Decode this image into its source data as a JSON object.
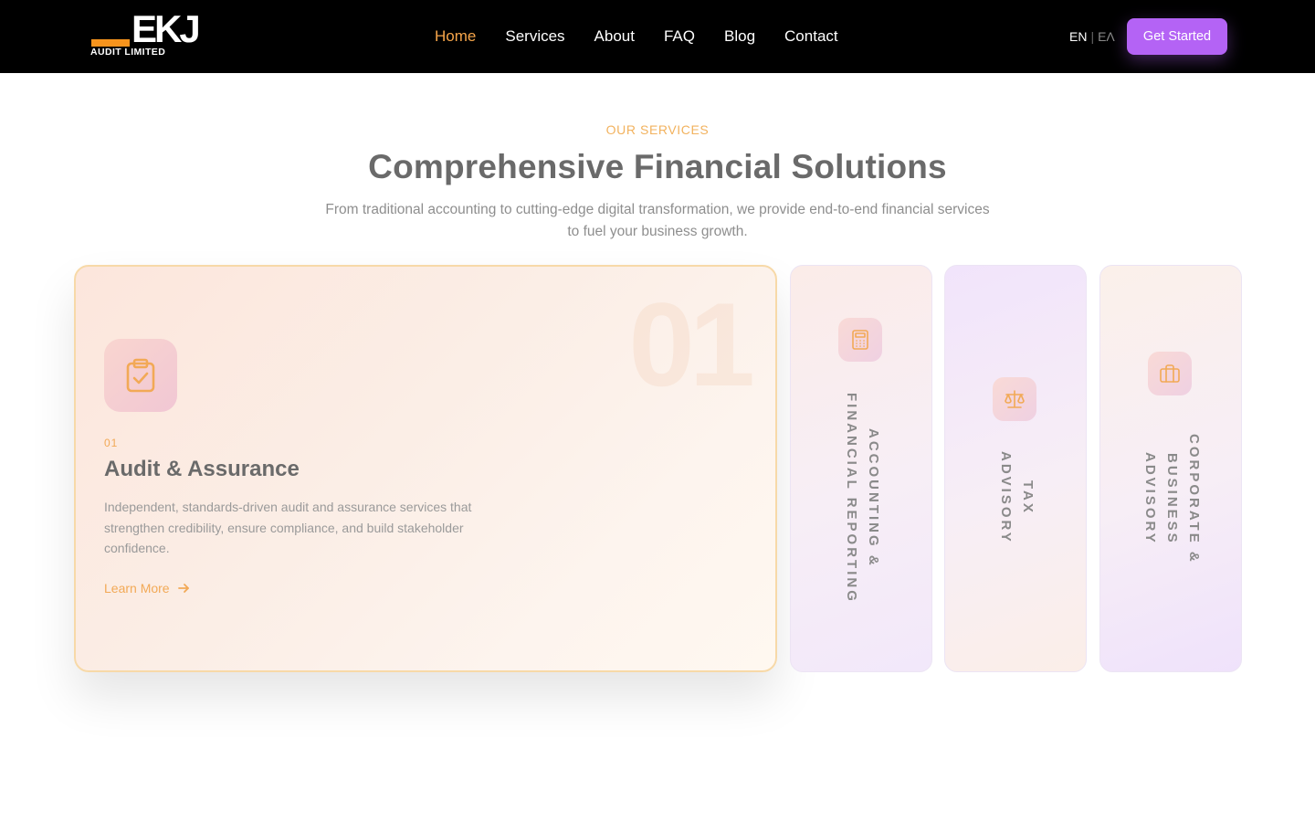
{
  "brand": {
    "mark": "EKJ",
    "sub": "AUDIT LIMITED",
    "accent": "#f7941d"
  },
  "nav": {
    "items": [
      {
        "label": "Home"
      },
      {
        "label": "Services"
      },
      {
        "label": "About"
      },
      {
        "label": "FAQ"
      },
      {
        "label": "Blog"
      },
      {
        "label": "Contact"
      }
    ],
    "active_color": "#f6a54a"
  },
  "lang": {
    "current": "EN",
    "separator": "|",
    "other": "ΕΛ"
  },
  "cta": {
    "label": "Get Started",
    "color": "#b463f5"
  },
  "section": {
    "eyebrow": "OUR SERVICES",
    "title": "Comprehensive Financial Solutions",
    "subtitle": "From traditional accounting to cutting-edge digital transformation, we provide end-to-end financial services to fuel your business growth."
  },
  "services": {
    "active": {
      "watermark": "01",
      "number": "01",
      "title": "Audit & Assurance",
      "description": "Independent, standards-driven audit and assurance services that strengthen credibility, ensure compliance, and build stakeholder confidence.",
      "link": "Learn More",
      "icon": "clipboard-check-icon"
    },
    "collapsed": [
      {
        "label": "ACCOUNTING & FINANCIAL REPORTING",
        "icon": "calculator-icon"
      },
      {
        "label": "TAX ADVISORY",
        "icon": "scale-icon"
      },
      {
        "label": "CORPORATE & BUSINESS ADVISORY",
        "icon": "briefcase-icon"
      }
    ]
  }
}
